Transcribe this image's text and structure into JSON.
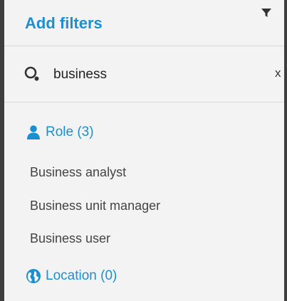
{
  "header": {
    "title": "Add filters"
  },
  "search": {
    "value": "business",
    "clear_label": "x"
  },
  "groups": [
    {
      "label": "Role (3)",
      "icon": "person-icon",
      "options": [
        "Business analyst",
        "Business unit manager",
        "Business user"
      ]
    },
    {
      "label": "Location (0)",
      "icon": "globe-icon",
      "options": []
    }
  ],
  "colors": {
    "accent": "#1a8fd1",
    "panel_bg": "#f3f3f3",
    "border": "#3e3e3e"
  }
}
